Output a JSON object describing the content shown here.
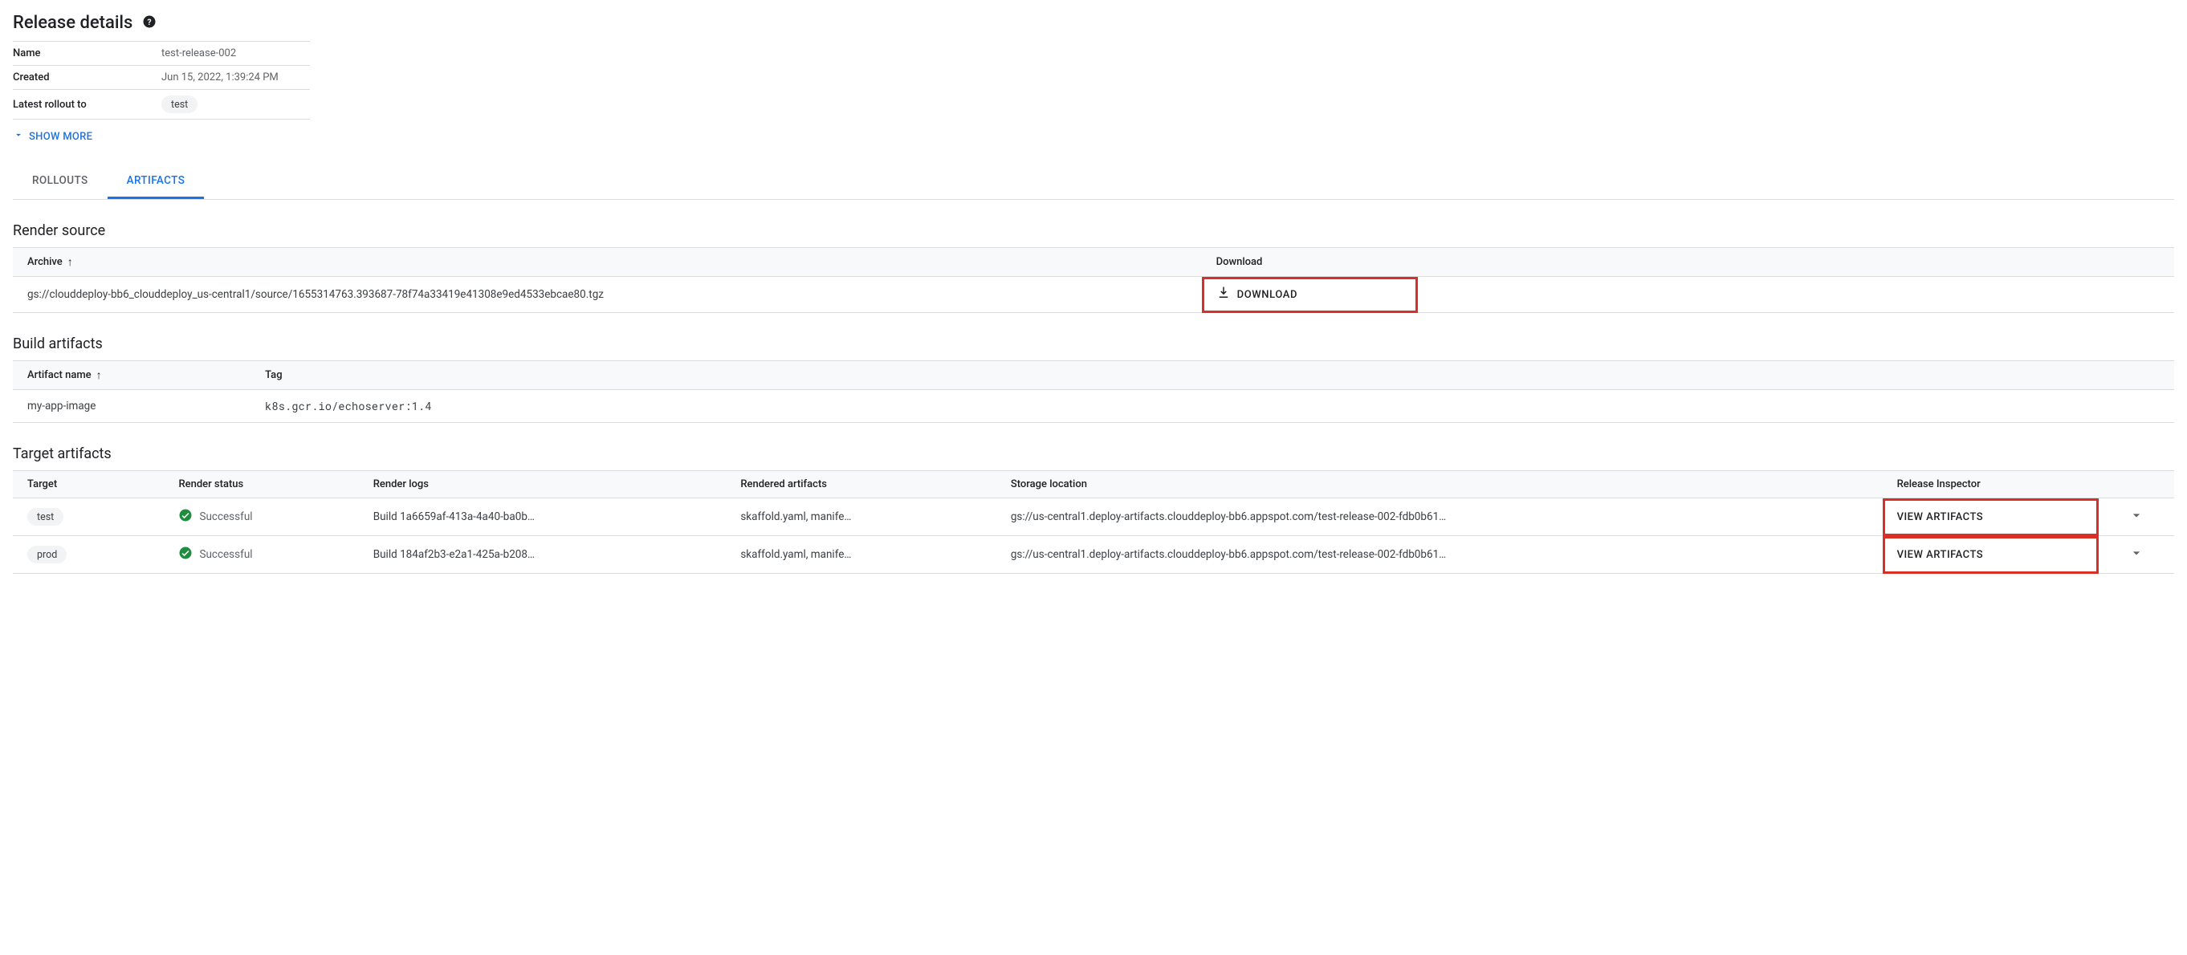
{
  "header": {
    "title": "Release details"
  },
  "details": {
    "rows": [
      {
        "label": "Name",
        "value": "test-release-002"
      },
      {
        "label": "Created",
        "value": "Jun 15, 2022, 1:39:24 PM"
      },
      {
        "label": "Latest rollout to",
        "badge": "test"
      }
    ],
    "show_more": "SHOW MORE"
  },
  "tabs": [
    {
      "id": "rollouts",
      "label": "ROLLOUTS",
      "active": false
    },
    {
      "id": "artifacts",
      "label": "ARTIFACTS",
      "active": true
    }
  ],
  "render_source": {
    "heading": "Render source",
    "columns": {
      "archive": "Archive",
      "download": "Download"
    },
    "row": {
      "archive": "gs://clouddeploy-bb6_clouddeploy_us-central1/source/1655314763.393687-78f74a33419e41308e9ed4533ebcae80.tgz",
      "download_label": "DOWNLOAD"
    }
  },
  "build_artifacts": {
    "heading": "Build artifacts",
    "columns": {
      "name": "Artifact name",
      "tag": "Tag"
    },
    "row": {
      "name": "my-app-image",
      "tag": "k8s.gcr.io/echoserver:1.4"
    }
  },
  "target_artifacts": {
    "heading": "Target artifacts",
    "columns": {
      "target": "Target",
      "render_status": "Render status",
      "render_logs": "Render logs",
      "rendered_artifacts": "Rendered artifacts",
      "storage_location": "Storage location",
      "release_inspector": "Release Inspector"
    },
    "status_success": "Successful",
    "view_artifacts_label": "VIEW ARTIFACTS",
    "rows": [
      {
        "target": "test",
        "render_logs": "Build 1a6659af-413a-4a40-ba0b…",
        "rendered_artifacts": "skaffold.yaml, manife…",
        "storage_location": "gs://us-central1.deploy-artifacts.clouddeploy-bb6.appspot.com/test-release-002-fdb0b61…"
      },
      {
        "target": "prod",
        "render_logs": "Build 184af2b3-e2a1-425a-b208…",
        "rendered_artifacts": "skaffold.yaml, manife…",
        "storage_location": "gs://us-central1.deploy-artifacts.clouddeploy-bb6.appspot.com/test-release-002-fdb0b61…"
      }
    ]
  }
}
